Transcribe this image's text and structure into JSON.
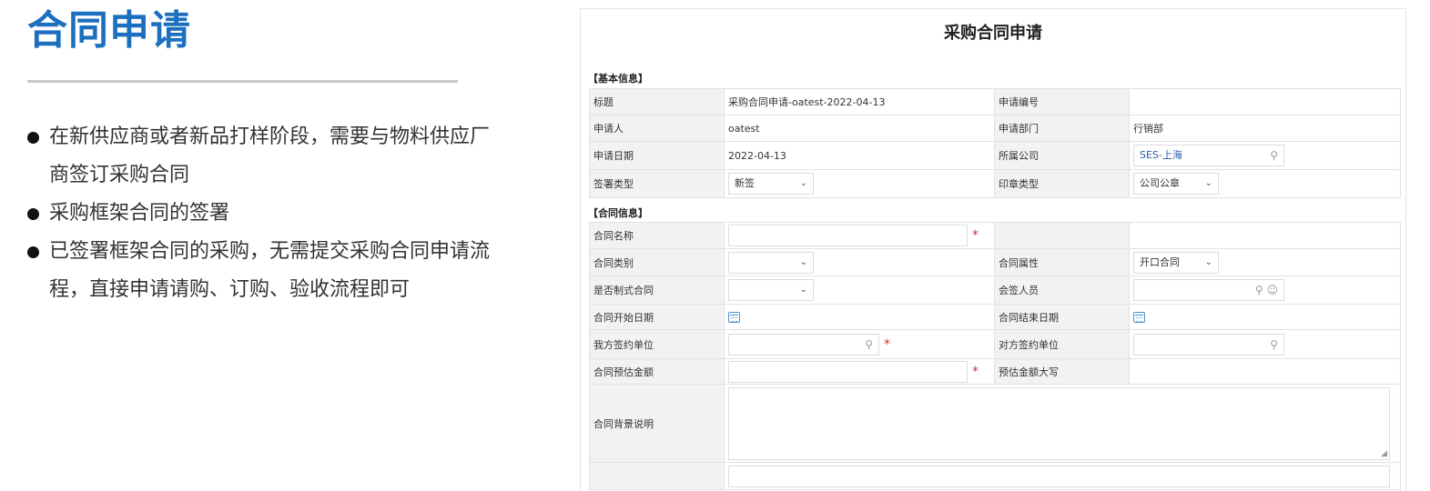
{
  "slide": {
    "title": "合同申请",
    "bullets": [
      "在新供应商或者新品打样阶段，需要与物料供应厂商签订采购合同",
      "采购框架合同的签署",
      "已签署框架合同的采购，无需提交采购合同申请流程，直接申请请购、订购、验收流程即可"
    ]
  },
  "form": {
    "title": "采购合同申请",
    "basic_section": "【基本信息】",
    "contract_section": "【合同信息】",
    "basic": {
      "title_label": "标题",
      "title_value": "采购合同申请-oatest-2022-04-13",
      "number_label": "申请编号",
      "number_value": "",
      "applicant_label": "申请人",
      "applicant_value": "oatest",
      "dept_label": "申请部门",
      "dept_value": "行销部",
      "date_label": "申请日期",
      "date_value": "2022-04-13",
      "company_label": "所属公司",
      "company_value": "SES-上海",
      "sign_type_label": "签署类型",
      "sign_type_value": "新签",
      "seal_type_label": "印章类型",
      "seal_type_value": "公司公章"
    },
    "contract": {
      "name_label": "合同名称",
      "category_label": "合同类别",
      "attribute_label": "合同属性",
      "attribute_value": "开口合同",
      "formatted_label": "是否制式合同",
      "cosign_label": "会签人员",
      "start_date_label": "合同开始日期",
      "end_date_label": "合同结束日期",
      "our_party_label": "我方签约单位",
      "other_party_label": "对方签约单位",
      "amount_label": "合同预估金额",
      "amount_upper_label": "预估金额大写",
      "background_label": "合同背景说明"
    },
    "required_mark": "*",
    "icons": {
      "search": "search-icon",
      "chevron": "chevron-down-icon",
      "calendar": "calendar-icon",
      "user_search": "user-search-icon"
    }
  }
}
